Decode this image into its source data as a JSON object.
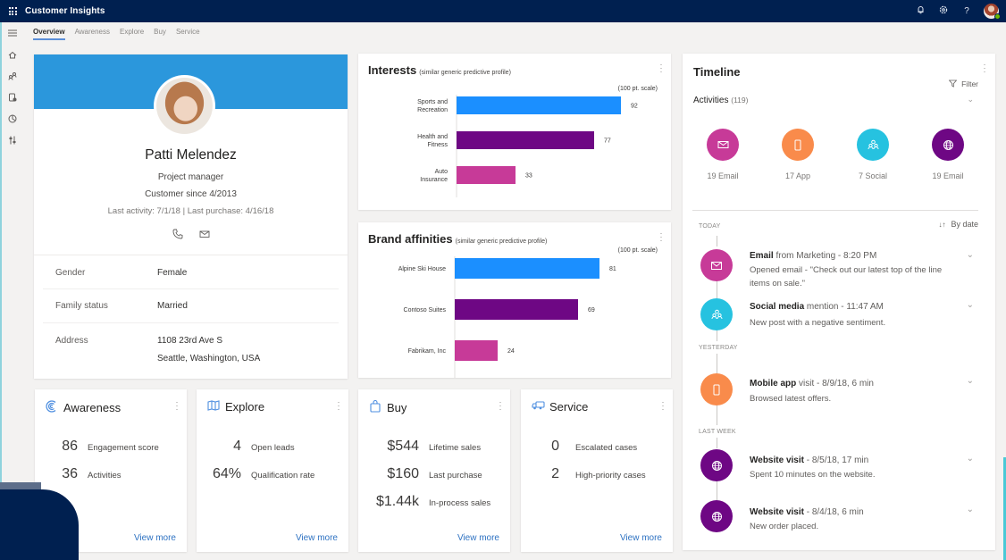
{
  "app": {
    "title": "Customer Insights",
    "top_icons": [
      "bell-icon",
      "gear-icon",
      "help-icon"
    ]
  },
  "tabs": [
    {
      "label": "Overview",
      "active": true
    },
    {
      "label": "Awareness",
      "active": false
    },
    {
      "label": "Explore",
      "active": false
    },
    {
      "label": "Buy",
      "active": false
    },
    {
      "label": "Service",
      "active": false
    }
  ],
  "leftnav": [
    "hamburger-icon",
    "home-icon",
    "segments-icon",
    "profiles-icon",
    "insights-icon",
    "settings-icon"
  ],
  "profile": {
    "name": "Patti Melendez",
    "title": "Project manager",
    "customer_since": "Customer since 4/2013",
    "activity_line": "Last activity: 7/1/18  |  Last purchase: 4/16/18",
    "banner_color": "#2b97dc",
    "properties": [
      {
        "label": "Gender",
        "value": "Female",
        "value2": ""
      },
      {
        "label": "Family status",
        "value": "Married",
        "value2": ""
      },
      {
        "label": "Address",
        "value": "1108 23rd Ave S",
        "value2": "Seattle, Washington, USA"
      }
    ]
  },
  "chart_data": [
    {
      "type": "bar",
      "orientation": "horizontal",
      "title": "Interests",
      "subtitle": "(similar generic predictive profile)",
      "scale_label": "(100 pt. scale)",
      "categories": [
        [
          "Sports and",
          "Recreation"
        ],
        [
          "Health and",
          "Fitness"
        ],
        [
          "Auto",
          "Insurance"
        ]
      ],
      "values": [
        92,
        77,
        33
      ],
      "colors": [
        "#1b8fff",
        "#6e0784",
        "#c73a98"
      ],
      "xlim": [
        0,
        100
      ],
      "grid": false
    },
    {
      "type": "bar",
      "orientation": "horizontal",
      "title": "Brand affinities",
      "subtitle": "(similar generic predictive profile)",
      "scale_label": "(100 pt. scale)",
      "categories": [
        [
          "Alpine Ski House"
        ],
        [
          "Contoso Suites"
        ],
        [
          "Fabrikam, Inc"
        ]
      ],
      "values": [
        81,
        69,
        24
      ],
      "colors": [
        "#1b8fff",
        "#6e0784",
        "#c73a98"
      ],
      "xlim": [
        0,
        100
      ],
      "grid": false
    }
  ],
  "kpis": [
    {
      "title": "Awareness",
      "icon": "awareness-icon",
      "rows": [
        {
          "num": "86",
          "label": "Engagement score"
        },
        {
          "num": "36",
          "label": "Activities"
        }
      ],
      "link": "View more"
    },
    {
      "title": "Explore",
      "icon": "map-icon",
      "rows": [
        {
          "num": "4",
          "label": "Open leads"
        },
        {
          "num": "64%",
          "label": "Qualification rate"
        }
      ],
      "link": "View more"
    },
    {
      "title": "Buy",
      "icon": "shopping-bag-icon",
      "rows": [
        {
          "num": "$544",
          "label": "Lifetime sales"
        },
        {
          "num": "$160",
          "label": "Last purchase"
        },
        {
          "num": "$1.44k",
          "label": "In-process sales"
        }
      ],
      "link": "View more"
    },
    {
      "title": "Service",
      "icon": "truck-icon",
      "rows": [
        {
          "num": "0",
          "label": "Escalated cases"
        },
        {
          "num": "2",
          "label": "High-priority cases"
        }
      ],
      "link": "View more"
    }
  ],
  "timeline": {
    "title": "Timeline",
    "filter_label": "Filter",
    "activities_label": "Activities",
    "activities_count": "(119)",
    "sort_label": "By date",
    "summary": [
      {
        "label": "19 Email",
        "icon": "email-icon",
        "color": "#c73a98"
      },
      {
        "label": "17 App",
        "icon": "phone-icon",
        "color": "#f98b4b"
      },
      {
        "label": "7 Social",
        "icon": "social-icon",
        "color": "#26c2e0"
      },
      {
        "label": "19 Email",
        "icon": "globe-icon",
        "color": "#6e0784"
      }
    ],
    "groups": [
      {
        "day": "TODAY"
      },
      {
        "day": "YESTERDAY"
      },
      {
        "day": "LAST WEEK"
      }
    ],
    "items": [
      {
        "bold": "Email",
        "rest": " from Marketing - 8:20 PM",
        "desc": "Opened  email - \"Check out our latest top of the line items on sale.\"",
        "icon": "email-icon",
        "color": "#c73a98"
      },
      {
        "bold": "Social media",
        "rest": " mention - 11:47 AM",
        "desc": "New post with a negative sentiment.",
        "icon": "social-icon",
        "color": "#26c2e0"
      },
      {
        "bold": "Mobile app",
        "rest": " visit - 8/9/18, 6 min",
        "desc": "Browsed latest offers.",
        "icon": "phone-icon",
        "color": "#f98b4b"
      },
      {
        "bold": "Website visit",
        "rest": " - 8/5/18, 17 min",
        "desc": "Spent 10 minutes on the website.",
        "icon": "globe-icon",
        "color": "#6e0784"
      },
      {
        "bold": "Website visit",
        "rest": " - 8/4/18, 6 min",
        "desc": "New order placed.",
        "icon": "globe-icon",
        "color": "#6e0784"
      }
    ]
  }
}
